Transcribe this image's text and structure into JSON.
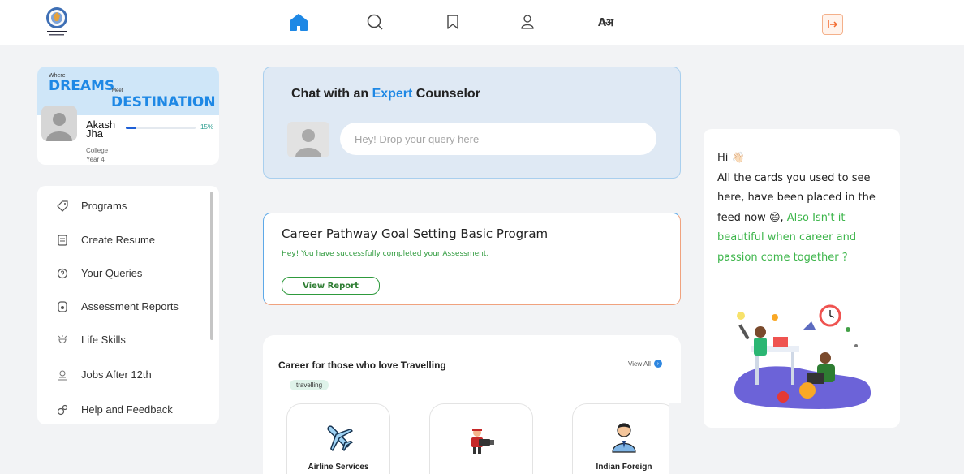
{
  "nav": {
    "icons": [
      "home-icon",
      "search-icon",
      "bookmark-icon",
      "profile-icon",
      "language-icon",
      "logout-icon"
    ],
    "lang_label": "Aअ",
    "active": "home",
    "accent": "#1e88e5"
  },
  "profile": {
    "where": "Where",
    "dreams": "DREAMS",
    "meet": "Meet",
    "destination": "DESTINATION",
    "name": "Akash Jha",
    "progress_percent": 15,
    "progress_label": "15%",
    "type": "College",
    "year": "Year 4"
  },
  "sidebar": {
    "items": [
      {
        "label": "Programs",
        "icon": "tag-icon"
      },
      {
        "label": "Create Resume",
        "icon": "document-icon"
      },
      {
        "label": "Your Queries",
        "icon": "query-icon"
      },
      {
        "label": "Assessment Reports",
        "icon": "report-icon"
      },
      {
        "label": "Life Skills",
        "icon": "life-skills-icon"
      },
      {
        "label": "Jobs After 12th",
        "icon": "jobs-icon"
      },
      {
        "label": "Help and Feedback",
        "icon": "help-icon"
      }
    ]
  },
  "chat": {
    "title_prefix": "Chat with an ",
    "title_highlight": "Expert",
    "title_suffix": " Counselor",
    "placeholder": "Hey! Drop your query here"
  },
  "pathway": {
    "title": "Career Pathway Goal Setting Basic Program",
    "message": "Hey! You have successfully completed your Assessment.",
    "button": "View Report"
  },
  "travel": {
    "title": "Career for those who love Travelling",
    "view_all": "View All",
    "tag": "travelling",
    "careers": [
      {
        "label": "Airline Services",
        "icon": "airplane-icon"
      },
      {
        "label": "",
        "icon": "cameraman-icon"
      },
      {
        "label": "Indian Foreign",
        "icon": "diplomat-icon"
      }
    ]
  },
  "info": {
    "greeting": "Hi",
    "line_normal": "All the cards you used to see here, have been placed in the feed now",
    "line_green": "Also Isn't it beautiful when career and passion come together ?"
  }
}
